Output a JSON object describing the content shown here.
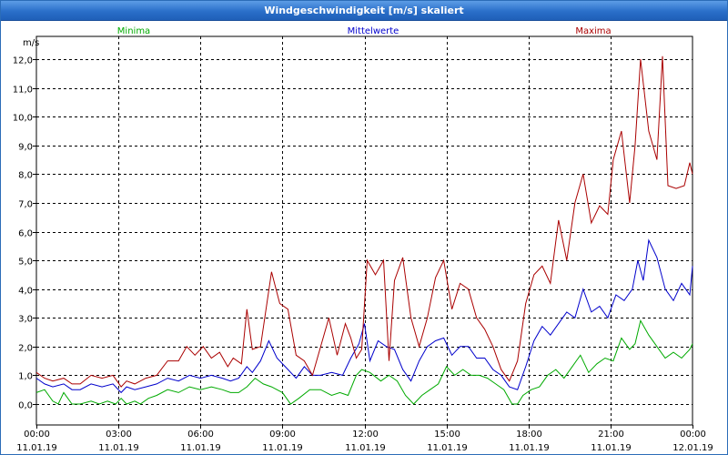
{
  "window": {
    "title": "Windgeschwindigkeit [m/s] skaliert"
  },
  "chart_data": {
    "type": "line",
    "title": "Windgeschwindigkeit [m/s] skaliert",
    "ylabel": "m/s",
    "ylim": [
      -0.2,
      12.5
    ],
    "xlim": [
      0,
      24
    ],
    "grid": true,
    "legend": "top",
    "y_ticks": [
      "0,0",
      "1,0",
      "2,0",
      "3,0",
      "4,0",
      "5,0",
      "6,0",
      "7,0",
      "8,0",
      "9,0",
      "10,0",
      "11,0",
      "12,0"
    ],
    "x_ticks": [
      {
        "time": "00:00",
        "date": "11.01.19"
      },
      {
        "time": "03:00",
        "date": "11.01.19"
      },
      {
        "time": "06:00",
        "date": "11.01.19"
      },
      {
        "time": "09:00",
        "date": "11.01.19"
      },
      {
        "time": "12:00",
        "date": "11.01.19"
      },
      {
        "time": "15:00",
        "date": "11.01.19"
      },
      {
        "time": "18:00",
        "date": "11.01.19"
      },
      {
        "time": "21:00",
        "date": "11.01.19"
      },
      {
        "time": "00:00",
        "date": "12.01.19"
      }
    ],
    "series": [
      {
        "name": "Minima",
        "color": "#00aa00",
        "points": [
          [
            0,
            0.4
          ],
          [
            0.3,
            0.5
          ],
          [
            0.6,
            0.1
          ],
          [
            0.8,
            0.0
          ],
          [
            1.0,
            0.4
          ],
          [
            1.3,
            0.0
          ],
          [
            1.6,
            0.0
          ],
          [
            2.0,
            0.1
          ],
          [
            2.3,
            0.0
          ],
          [
            2.6,
            0.1
          ],
          [
            2.9,
            0.0
          ],
          [
            3.1,
            0.2
          ],
          [
            3.3,
            0.0
          ],
          [
            3.6,
            0.1
          ],
          [
            3.8,
            0.0
          ],
          [
            4.1,
            0.2
          ],
          [
            4.4,
            0.3
          ],
          [
            4.8,
            0.5
          ],
          [
            5.2,
            0.4
          ],
          [
            5.6,
            0.6
          ],
          [
            6.0,
            0.5
          ],
          [
            6.4,
            0.6
          ],
          [
            6.8,
            0.5
          ],
          [
            7.1,
            0.4
          ],
          [
            7.4,
            0.4
          ],
          [
            7.7,
            0.6
          ],
          [
            8.0,
            0.9
          ],
          [
            8.3,
            0.7
          ],
          [
            8.6,
            0.6
          ],
          [
            9.0,
            0.4
          ],
          [
            9.3,
            0.0
          ],
          [
            9.6,
            0.2
          ],
          [
            10.0,
            0.5
          ],
          [
            10.4,
            0.5
          ],
          [
            10.8,
            0.3
          ],
          [
            11.1,
            0.4
          ],
          [
            11.4,
            0.3
          ],
          [
            11.7,
            1.0
          ],
          [
            11.9,
            1.2
          ],
          [
            12.2,
            1.1
          ],
          [
            12.6,
            0.8
          ],
          [
            12.9,
            1.0
          ],
          [
            13.2,
            0.8
          ],
          [
            13.5,
            0.3
          ],
          [
            13.8,
            0.0
          ],
          [
            14.1,
            0.3
          ],
          [
            14.4,
            0.5
          ],
          [
            14.7,
            0.7
          ],
          [
            15.0,
            1.3
          ],
          [
            15.3,
            1.0
          ],
          [
            15.6,
            1.2
          ],
          [
            15.9,
            1.0
          ],
          [
            16.2,
            1.0
          ],
          [
            16.5,
            0.9
          ],
          [
            16.8,
            0.7
          ],
          [
            17.1,
            0.5
          ],
          [
            17.4,
            0.0
          ],
          [
            17.6,
            0.0
          ],
          [
            17.8,
            0.3
          ],
          [
            18.1,
            0.5
          ],
          [
            18.4,
            0.6
          ],
          [
            18.7,
            1.0
          ],
          [
            19.0,
            1.2
          ],
          [
            19.3,
            0.9
          ],
          [
            19.6,
            1.3
          ],
          [
            19.9,
            1.7
          ],
          [
            20.2,
            1.1
          ],
          [
            20.5,
            1.4
          ],
          [
            20.8,
            1.6
          ],
          [
            21.1,
            1.5
          ],
          [
            21.4,
            2.3
          ],
          [
            21.7,
            1.9
          ],
          [
            21.9,
            2.1
          ],
          [
            22.1,
            2.9
          ],
          [
            22.4,
            2.4
          ],
          [
            22.7,
            2.0
          ],
          [
            23.0,
            1.6
          ],
          [
            23.3,
            1.8
          ],
          [
            23.6,
            1.6
          ],
          [
            23.9,
            1.9
          ],
          [
            24.0,
            2.1
          ]
        ]
      },
      {
        "name": "Mittelwerte",
        "color": "#0000cc",
        "points": [
          [
            0,
            0.9
          ],
          [
            0.3,
            0.7
          ],
          [
            0.6,
            0.6
          ],
          [
            1.0,
            0.7
          ],
          [
            1.3,
            0.5
          ],
          [
            1.6,
            0.5
          ],
          [
            2.0,
            0.7
          ],
          [
            2.4,
            0.6
          ],
          [
            2.8,
            0.7
          ],
          [
            3.1,
            0.4
          ],
          [
            3.3,
            0.6
          ],
          [
            3.6,
            0.5
          ],
          [
            4.0,
            0.6
          ],
          [
            4.4,
            0.7
          ],
          [
            4.8,
            0.9
          ],
          [
            5.2,
            0.8
          ],
          [
            5.6,
            1.0
          ],
          [
            6.0,
            0.9
          ],
          [
            6.4,
            1.0
          ],
          [
            6.8,
            0.9
          ],
          [
            7.1,
            0.8
          ],
          [
            7.4,
            0.9
          ],
          [
            7.7,
            1.3
          ],
          [
            7.9,
            1.1
          ],
          [
            8.2,
            1.5
          ],
          [
            8.5,
            2.2
          ],
          [
            8.8,
            1.6
          ],
          [
            9.1,
            1.3
          ],
          [
            9.5,
            0.9
          ],
          [
            9.8,
            1.3
          ],
          [
            10.1,
            1.0
          ],
          [
            10.4,
            1.0
          ],
          [
            10.8,
            1.1
          ],
          [
            11.2,
            1.0
          ],
          [
            11.5,
            1.6
          ],
          [
            11.8,
            2.1
          ],
          [
            12.0,
            2.8
          ],
          [
            12.2,
            1.5
          ],
          [
            12.5,
            2.2
          ],
          [
            12.8,
            2.0
          ],
          [
            13.1,
            1.9
          ],
          [
            13.4,
            1.2
          ],
          [
            13.7,
            0.8
          ],
          [
            14.0,
            1.5
          ],
          [
            14.3,
            2.0
          ],
          [
            14.6,
            2.2
          ],
          [
            14.9,
            2.3
          ],
          [
            15.2,
            1.7
          ],
          [
            15.5,
            2.0
          ],
          [
            15.8,
            2.0
          ],
          [
            16.1,
            1.6
          ],
          [
            16.4,
            1.6
          ],
          [
            16.7,
            1.2
          ],
          [
            17.0,
            1.0
          ],
          [
            17.3,
            0.6
          ],
          [
            17.6,
            0.5
          ],
          [
            17.9,
            1.3
          ],
          [
            18.2,
            2.2
          ],
          [
            18.5,
            2.7
          ],
          [
            18.8,
            2.4
          ],
          [
            19.1,
            2.8
          ],
          [
            19.4,
            3.2
          ],
          [
            19.7,
            3.0
          ],
          [
            20.0,
            4.0
          ],
          [
            20.3,
            3.2
          ],
          [
            20.6,
            3.4
          ],
          [
            20.9,
            3.0
          ],
          [
            21.2,
            3.8
          ],
          [
            21.5,
            3.6
          ],
          [
            21.8,
            4.0
          ],
          [
            22.0,
            5.0
          ],
          [
            22.2,
            4.3
          ],
          [
            22.4,
            5.7
          ],
          [
            22.7,
            5.1
          ],
          [
            23.0,
            4.0
          ],
          [
            23.3,
            3.6
          ],
          [
            23.6,
            4.2
          ],
          [
            23.9,
            3.8
          ],
          [
            24.0,
            4.8
          ]
        ]
      },
      {
        "name": "Maxima",
        "color": "#aa0000",
        "points": [
          [
            0,
            1.1
          ],
          [
            0.3,
            0.9
          ],
          [
            0.6,
            0.8
          ],
          [
            1.0,
            0.9
          ],
          [
            1.3,
            0.7
          ],
          [
            1.6,
            0.7
          ],
          [
            2.0,
            1.0
          ],
          [
            2.4,
            0.9
          ],
          [
            2.8,
            1.0
          ],
          [
            3.1,
            0.6
          ],
          [
            3.3,
            0.8
          ],
          [
            3.6,
            0.7
          ],
          [
            4.0,
            0.9
          ],
          [
            4.4,
            1.0
          ],
          [
            4.8,
            1.5
          ],
          [
            5.2,
            1.5
          ],
          [
            5.5,
            2.0
          ],
          [
            5.8,
            1.7
          ],
          [
            6.1,
            2.0
          ],
          [
            6.4,
            1.6
          ],
          [
            6.7,
            1.8
          ],
          [
            7.0,
            1.3
          ],
          [
            7.2,
            1.6
          ],
          [
            7.5,
            1.4
          ],
          [
            7.7,
            3.3
          ],
          [
            7.9,
            1.9
          ],
          [
            8.2,
            2.0
          ],
          [
            8.6,
            4.6
          ],
          [
            8.9,
            3.5
          ],
          [
            9.2,
            3.3
          ],
          [
            9.5,
            1.7
          ],
          [
            9.8,
            1.5
          ],
          [
            10.1,
            1.0
          ],
          [
            10.4,
            2.0
          ],
          [
            10.7,
            3.0
          ],
          [
            11.0,
            1.7
          ],
          [
            11.3,
            2.8
          ],
          [
            11.5,
            2.3
          ],
          [
            11.7,
            1.6
          ],
          [
            11.9,
            1.9
          ],
          [
            12.1,
            5.0
          ],
          [
            12.4,
            4.5
          ],
          [
            12.7,
            5.0
          ],
          [
            12.9,
            1.5
          ],
          [
            13.1,
            4.3
          ],
          [
            13.4,
            5.1
          ],
          [
            13.7,
            3.0
          ],
          [
            14.0,
            2.0
          ],
          [
            14.3,
            3.0
          ],
          [
            14.6,
            4.4
          ],
          [
            14.9,
            5.0
          ],
          [
            15.2,
            3.3
          ],
          [
            15.5,
            4.2
          ],
          [
            15.8,
            4.0
          ],
          [
            16.1,
            3.0
          ],
          [
            16.4,
            2.6
          ],
          [
            16.7,
            2.0
          ],
          [
            17.0,
            1.2
          ],
          [
            17.3,
            0.8
          ],
          [
            17.6,
            1.5
          ],
          [
            17.9,
            3.5
          ],
          [
            18.2,
            4.5
          ],
          [
            18.5,
            4.8
          ],
          [
            18.8,
            4.2
          ],
          [
            19.1,
            6.4
          ],
          [
            19.4,
            5.0
          ],
          [
            19.7,
            7.0
          ],
          [
            20.0,
            8.0
          ],
          [
            20.3,
            6.3
          ],
          [
            20.6,
            6.9
          ],
          [
            20.9,
            6.6
          ],
          [
            21.1,
            8.5
          ],
          [
            21.4,
            9.5
          ],
          [
            21.7,
            7.0
          ],
          [
            21.9,
            9.0
          ],
          [
            22.1,
            12.0
          ],
          [
            22.4,
            9.5
          ],
          [
            22.7,
            8.5
          ],
          [
            22.9,
            12.1
          ],
          [
            23.1,
            7.6
          ],
          [
            23.4,
            7.5
          ],
          [
            23.7,
            7.6
          ],
          [
            23.9,
            8.4
          ],
          [
            24.0,
            8.0
          ]
        ]
      }
    ]
  }
}
